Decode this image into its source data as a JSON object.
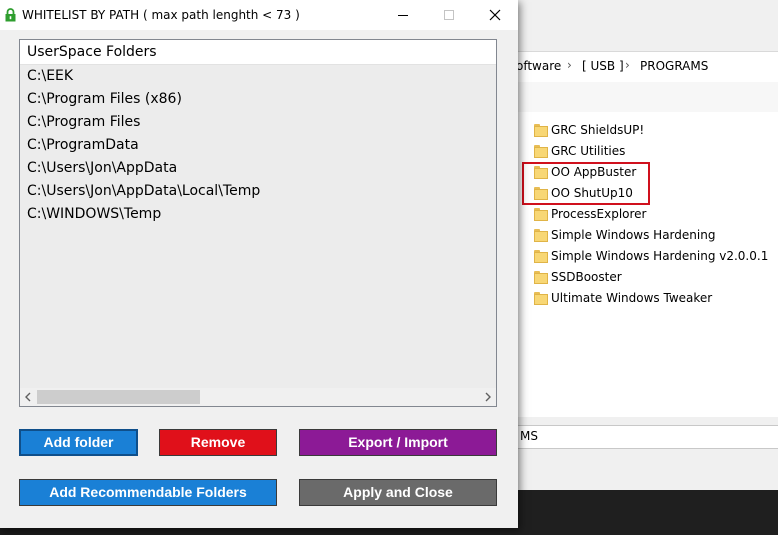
{
  "dialog": {
    "title": "WHITELIST BY PATH ( max path lenghth < 73 )",
    "list_header": "UserSpace Folders",
    "folders": [
      "C:\\EEK",
      "C:\\Program Files (x86)",
      "C:\\Program Files",
      "C:\\ProgramData",
      "C:\\Users\\Jon\\AppData",
      "C:\\Users\\Jon\\AppData\\Local\\Temp",
      "C:\\WINDOWS\\Temp"
    ],
    "buttons": {
      "add_folder": "Add folder",
      "remove": "Remove",
      "export_import": "Export / Import",
      "add_recommendable": "Add Recommendable Folders",
      "apply_close": "Apply and Close"
    },
    "colors": {
      "add": "#1a80d6",
      "remove": "#e0101a",
      "export": "#8c1a96",
      "apply": "#6a6a6a"
    }
  },
  "explorer": {
    "breadcrumb": [
      "oftware",
      "[ USB ]",
      "PROGRAMS"
    ],
    "items": [
      "GRC ShieldsUP!",
      "GRC Utilities",
      "OO AppBuster",
      "OO ShutUp10",
      "ProcessExplorer",
      "Simple Windows Hardening",
      "Simple Windows Hardening v2.0.0.1",
      "SSDBooster",
      "Ultimate Windows Tweaker"
    ],
    "status_text": "MS",
    "highlight_color": "#d0101d"
  }
}
